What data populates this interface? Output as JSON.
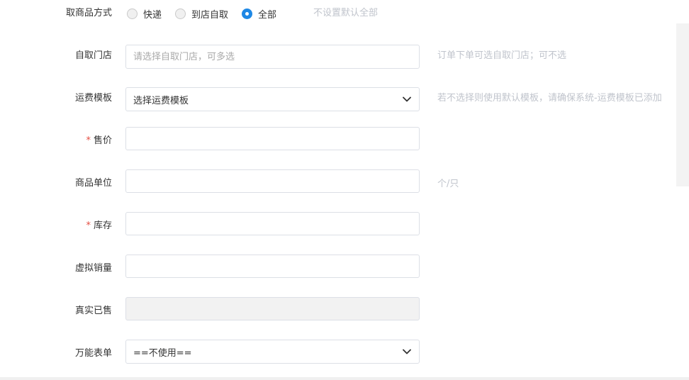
{
  "pickup_method": {
    "label": "取商品方式",
    "options": [
      {
        "label": "快递",
        "checked": false
      },
      {
        "label": "到店自取",
        "checked": false
      },
      {
        "label": "全部",
        "checked": true
      }
    ],
    "hint": "不设置默认全部"
  },
  "pickup_store": {
    "label": "自取门店",
    "placeholder": "请选择自取门店，可多选",
    "hint": "订单下单可选自取门店；可不选"
  },
  "shipping_template": {
    "label": "运费模板",
    "selected": "选择运费模板",
    "hint": "若不选择则使用默认模板，请确保系统-运费模板已添加"
  },
  "price": {
    "required_mark": "*",
    "label": "售价",
    "value": ""
  },
  "unit": {
    "label": "商品单位",
    "value": "",
    "hint": "个/只"
  },
  "stock": {
    "required_mark": "*",
    "label": "库存",
    "value": ""
  },
  "virtual_sales": {
    "label": "虚拟销量",
    "value": ""
  },
  "real_sales": {
    "label": "真实已售",
    "value": ""
  },
  "universal_form": {
    "label": "万能表单",
    "selected": "==不使用=="
  },
  "colors": {
    "accent": "#1e88e5",
    "required": "#e54d42",
    "hint": "#c0c4cc"
  }
}
